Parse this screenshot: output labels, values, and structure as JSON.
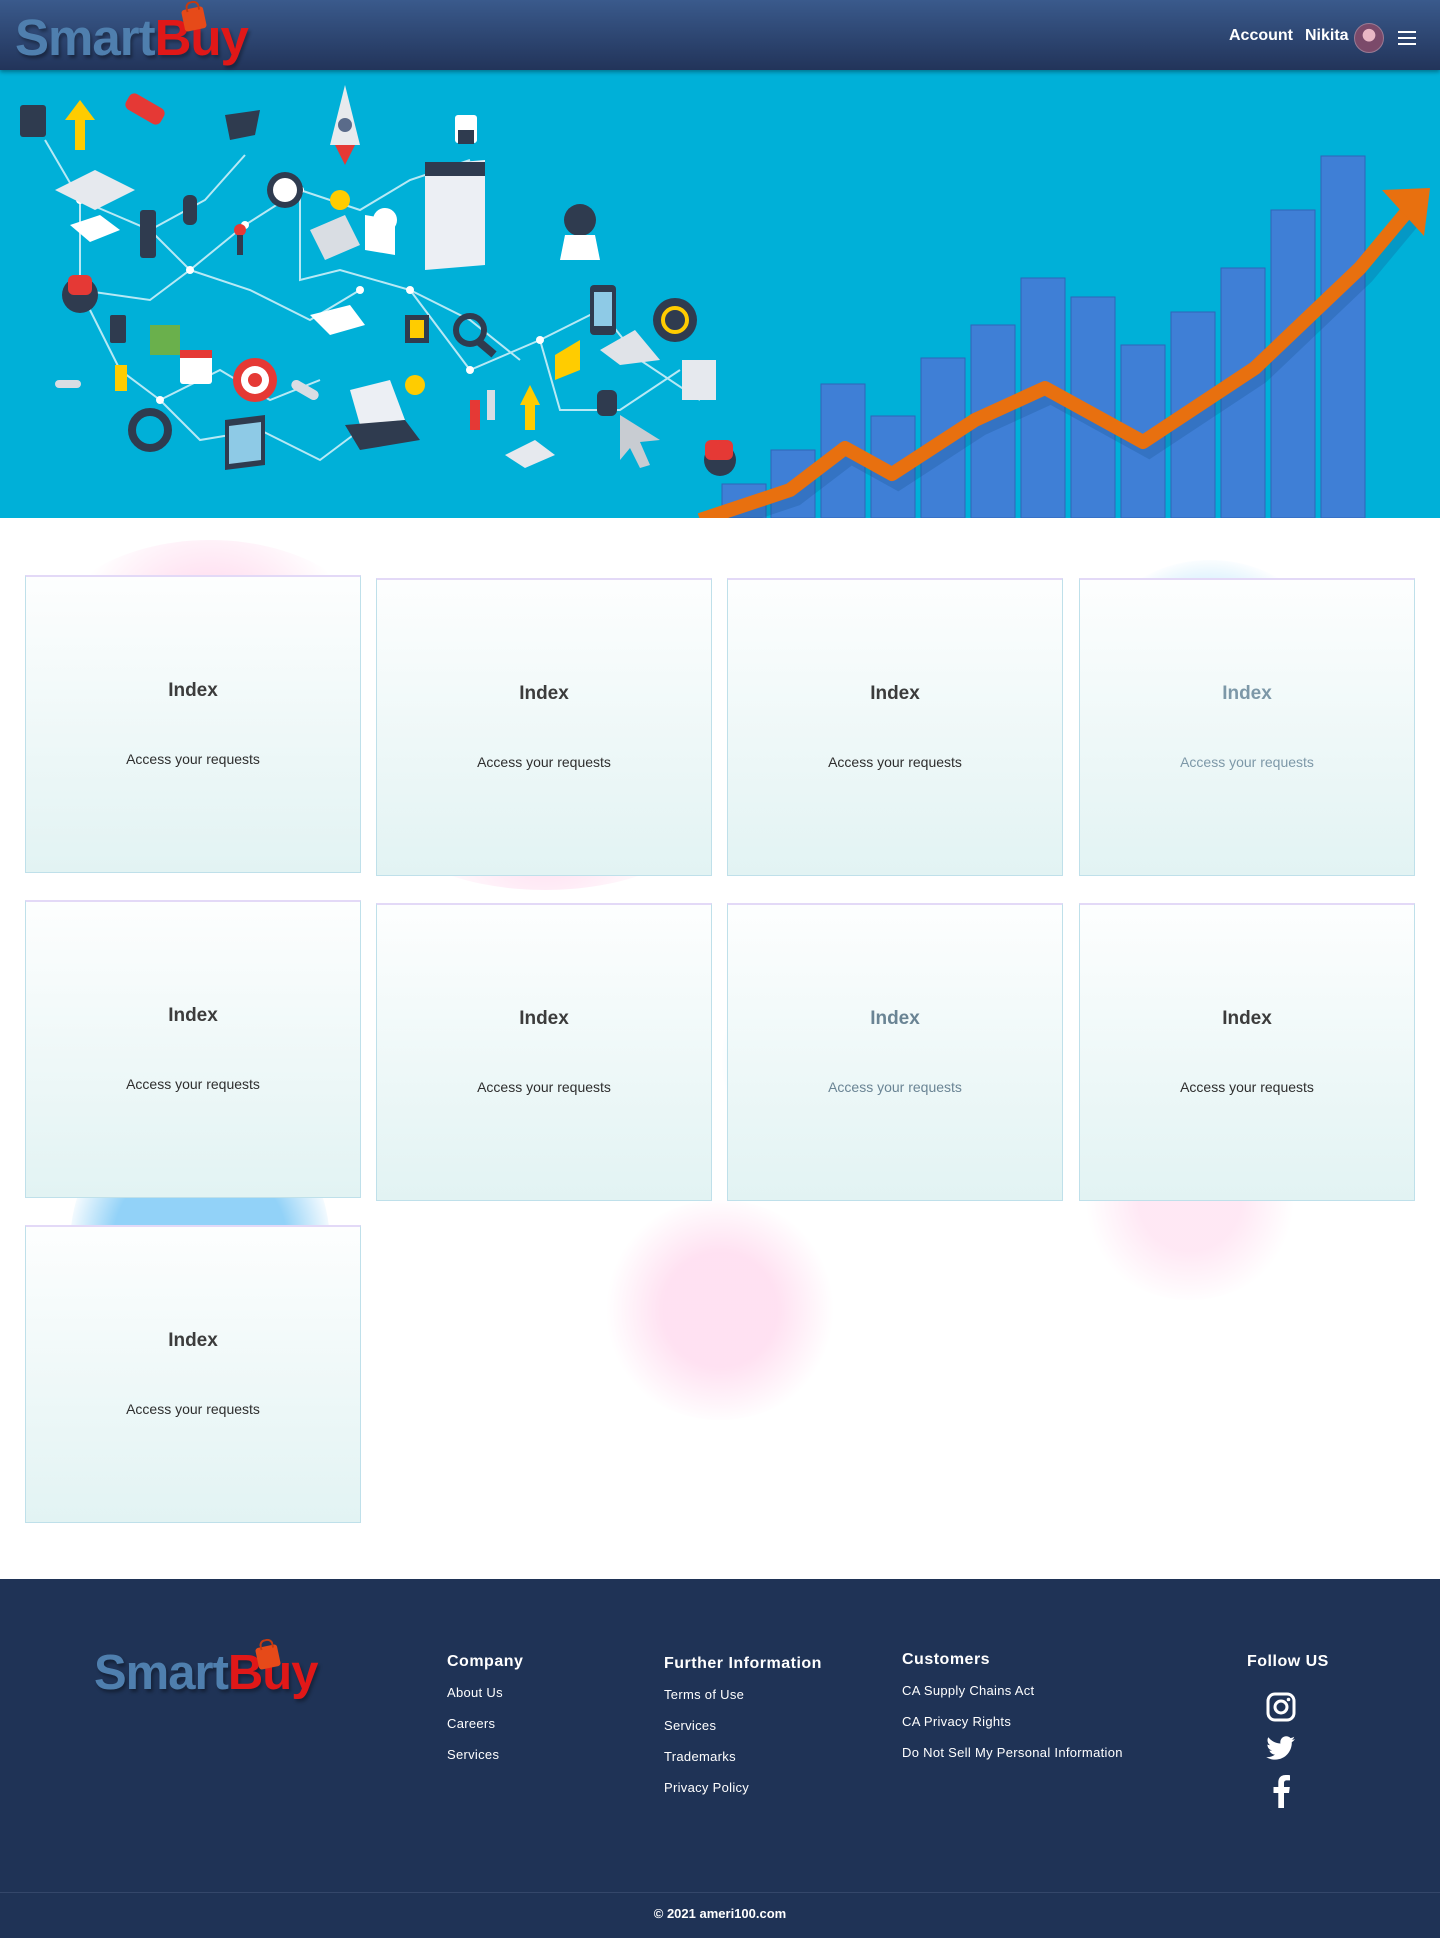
{
  "header": {
    "logo_main": "Smart",
    "logo_accent": "Buy",
    "account_label": "Account",
    "user_name": "Nikita"
  },
  "cards": [
    {
      "title": "Index",
      "description": "Access your requests"
    },
    {
      "title": "Index",
      "description": "Access your requests"
    },
    {
      "title": "Index",
      "description": "Access your requests"
    },
    {
      "title": "Index",
      "description": "Access your requests"
    },
    {
      "title": "Index",
      "description": "Access your requests"
    },
    {
      "title": "Index",
      "description": "Access your requests"
    },
    {
      "title": "Index",
      "description": "Access your requests"
    },
    {
      "title": "Index",
      "description": "Access your requests"
    },
    {
      "title": "Index",
      "description": "Access your requests"
    }
  ],
  "footer": {
    "logo_main": "Smart",
    "logo_accent": "Buy",
    "company": {
      "heading": "Company",
      "links": [
        "About Us",
        "Careers",
        "Services"
      ]
    },
    "further": {
      "heading": "Further Information",
      "links": [
        "Terms of Use",
        "Services",
        "Trademarks",
        "Privacy Policy"
      ]
    },
    "customers": {
      "heading": "Customers",
      "links": [
        "CA Supply Chains Act",
        "CA Privacy Rights",
        "Do Not Sell My Personal Information"
      ]
    },
    "follow": {
      "heading": "Follow US",
      "icons": [
        "instagram-icon",
        "twitter-icon",
        "facebook-icon"
      ]
    },
    "copyright": "© 2021 ameri100.com"
  },
  "colors": {
    "header": "#2c4570",
    "hero_bg": "#00b0d8",
    "footer_bg": "#1f3356",
    "logo_blue": "#4f7fae",
    "logo_red": "#e01818"
  }
}
